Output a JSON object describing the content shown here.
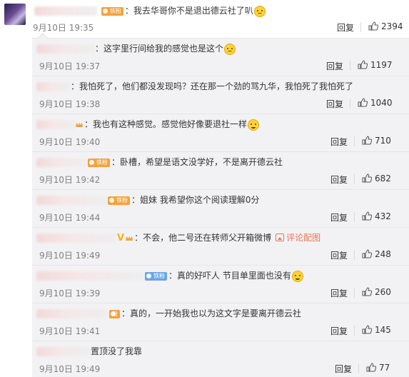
{
  "main_comment": {
    "text": "我去华哥你不是退出德云社了叭",
    "badge": "铁粉",
    "time": "9月10日 19:35",
    "reply_label": "回复",
    "likes": "2394"
  },
  "replies": [
    {
      "text": "这字里行间给我的感觉也是这个",
      "badge": "",
      "emoji": "smile",
      "time": "9月10日 19:37",
      "reply_label": "回复",
      "likes": "1197"
    },
    {
      "text": "我怕死了，他们都没发现吗？还在那一个劲的骂九华，我怕死了我怕死了",
      "badge": "",
      "emoji": "",
      "time": "9月10日 19:38",
      "reply_label": "回复",
      "likes": "1040"
    },
    {
      "text": "我也有这种感觉。感觉他好像要退社一样",
      "badge": "",
      "emoji": "cry",
      "time": "9月10日 19:40",
      "reply_label": "回复",
      "likes": "710"
    },
    {
      "text": "卧槽，希望是语文没学好，不是离开德云社",
      "badge": "铁粉",
      "emoji": "",
      "time": "9月10日 19:42",
      "reply_label": "回复",
      "likes": "682"
    },
    {
      "text": "姐妹 我希望你这个阅读理解0分",
      "badge": "铁粉",
      "emoji": "",
      "time": "9月10日 19:44",
      "reply_label": "回复",
      "likes": "432"
    },
    {
      "text": "不会，他二号还在转师父开箱微博",
      "badge": "",
      "emoji": "",
      "link": "评论配图",
      "time": "9月10日 19:49",
      "reply_label": "回复",
      "likes": "248"
    },
    {
      "text": "真的好吓人 节目单里面也没有",
      "badge": "铁粉",
      "emoji": "cry",
      "time": "9月10日 19:39",
      "reply_label": "回复",
      "likes": "260"
    },
    {
      "text": "真的，一开始我也以为这文字是要离开德云社",
      "badge": "粉",
      "emoji": "",
      "time": "9月10日 19:41",
      "reply_label": "回复",
      "likes": "145"
    },
    {
      "text": "置顶没了我靠",
      "badge": "",
      "emoji": "",
      "time": "9月10日 19:49",
      "reply_label": "回复",
      "likes": "77"
    }
  ],
  "colors": {
    "accent": "#eb7350",
    "badge_orange": "#f7a13a",
    "badge_blue": "#6aa6e6",
    "panel_bg": "#f2f2f5"
  },
  "icons": {
    "like": "thumbs-up-icon",
    "emoji": "face-emoji-icon",
    "pic": "image-icon"
  }
}
